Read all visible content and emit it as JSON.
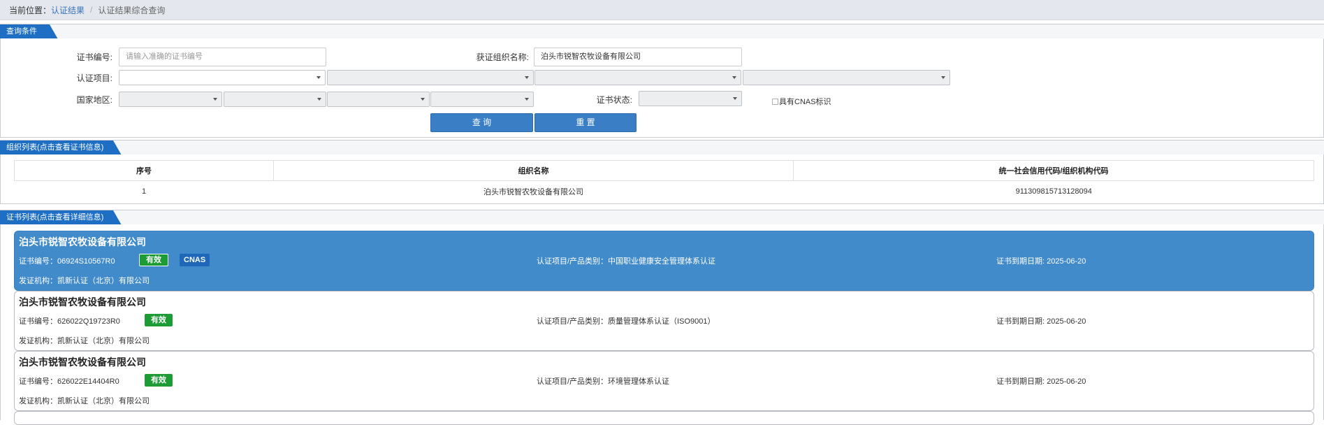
{
  "breadcrumb": {
    "prefix": "当前位置：",
    "link": "认证结果",
    "separator": "/",
    "current": "认证结果综合查询"
  },
  "query": {
    "section_title": "查询条件",
    "cert_no_label": "证书编号:",
    "cert_no_placeholder": "请输入准确的证书编号",
    "org_name_label": "获证组织名称:",
    "org_name_value": "泊头市锐智农牧设备有限公司",
    "project_label": "认证项目:",
    "region_label": "国家地区:",
    "status_label": "证书状态:",
    "cnas_label": "具有CNAS标识",
    "search_button": "查 询",
    "reset_button": "重 置"
  },
  "org_list": {
    "section_title": "组织列表(点击查看证书信息)",
    "columns": [
      "序号",
      "组织名称",
      "统一社会信用代码/组织机构代码"
    ],
    "rows": [
      [
        "1",
        "泊头市锐智农牧设备有限公司",
        "911309815713128094"
      ]
    ]
  },
  "cert_list": {
    "section_title": "证书列表(点击查看详细信息)",
    "items": [
      {
        "org": "泊头市锐智农牧设备有限公司",
        "cert_no": "证书编号：06924S10567R0",
        "status": "有效",
        "cnas": "CNAS",
        "project": "认证项目/产品类别：中国职业健康安全管理体系认证",
        "expiry": "证书到期日期: 2025-06-20",
        "issuer": "发证机构：凯新认证（北京）有限公司"
      },
      {
        "org": "泊头市锐智农牧设备有限公司",
        "cert_no": "证书编号：626022Q19723R0",
        "status": "有效",
        "project": "认证项目/产品类别：质量管理体系认证（ISO9001）",
        "expiry": "证书到期日期: 2025-06-20",
        "issuer": "发证机构：凯新认证（北京）有限公司"
      },
      {
        "org": "泊头市锐智农牧设备有限公司",
        "cert_no": "证书编号：626022E14404R0",
        "status": "有效",
        "project": "认证项目/产品类别：环境管理体系认证",
        "expiry": "证书到期日期: 2025-06-20",
        "issuer": "发证机构：凯新认证（北京）有限公司"
      }
    ]
  },
  "colors": {
    "accent": "#1e6fc4",
    "active_card": "#428bca",
    "valid_badge": "#1d9c36",
    "cnas_badge": "#1f67b8"
  }
}
